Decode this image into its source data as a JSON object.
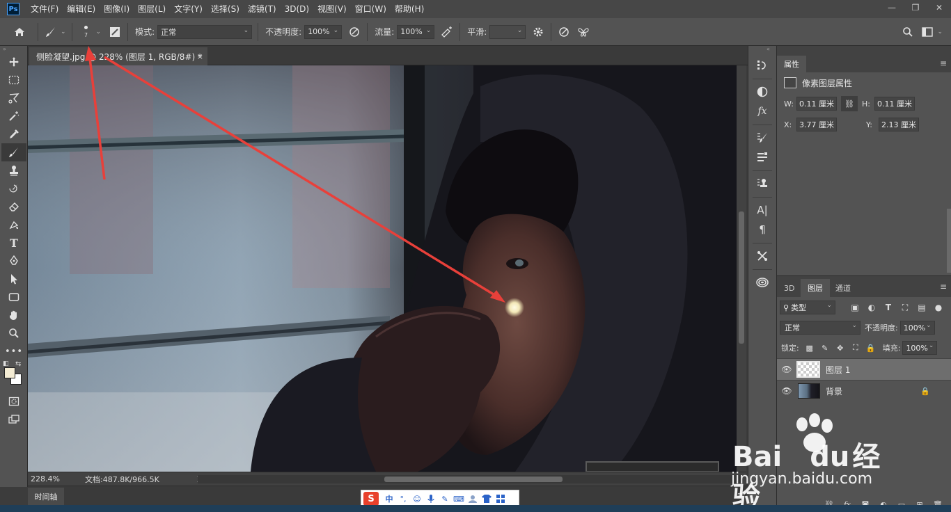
{
  "app": {
    "logo": "Ps"
  },
  "menu": [
    "文件(F)",
    "编辑(E)",
    "图像(I)",
    "图层(L)",
    "文字(Y)",
    "选择(S)",
    "滤镜(T)",
    "3D(D)",
    "视图(V)",
    "窗口(W)",
    "帮助(H)"
  ],
  "window_controls": {
    "minimize": "—",
    "restore": "❐",
    "close": "✕"
  },
  "options": {
    "brush_size": "7",
    "mode_label": "模式:",
    "mode_value": "正常",
    "opacity_label": "不透明度:",
    "opacity_value": "100%",
    "flow_label": "流量:",
    "flow_value": "100%",
    "smooth_label": "平滑:",
    "smooth_value": ""
  },
  "document": {
    "tab_title": "侧脸凝望.jpg @ 228% (图层 1, RGB/8#) *",
    "close": "×"
  },
  "status": {
    "zoom": "228.4%",
    "doc_size": "文档:487.8K/966.5K",
    "arrow": "❯"
  },
  "timeline": {
    "label": "时间轴"
  },
  "ime": {
    "logo": "S",
    "mode": "中",
    "punct": "°,",
    "items": [
      "☺",
      "🎤",
      "✎",
      "⌨",
      "👕",
      "▦"
    ]
  },
  "properties": {
    "tab": "属性",
    "head": "像素图层属性",
    "w_label": "W:",
    "w_value": "0.11 厘米",
    "h_label": "H:",
    "h_value": "0.11 厘米",
    "x_label": "X:",
    "x_value": "3.77 厘米",
    "y_label": "Y:",
    "y_value": "2.13 厘米"
  },
  "layers_panel": {
    "tabs": [
      "3D",
      "图层",
      "通道"
    ],
    "filter": "类型",
    "blend": "正常",
    "opacity_label": "不透明度:",
    "opacity_value": "100%",
    "lock_label": "锁定:",
    "fill_label": "填充:",
    "fill_value": "100%",
    "layers": [
      {
        "name": "图层 1",
        "selected": true,
        "thumb": "transparent"
      },
      {
        "name": "背景",
        "selected": false,
        "thumb": "photo",
        "locked": true
      }
    ]
  },
  "watermark": {
    "brand": "Bai",
    "brand2": "du",
    "service": "经验",
    "url": "jingyan.baidu.com"
  },
  "colors": {
    "menubar": "#474747",
    "panel": "#535353",
    "accent_arrow": "#e8403a",
    "ps_blue": "#4aa3ff"
  }
}
